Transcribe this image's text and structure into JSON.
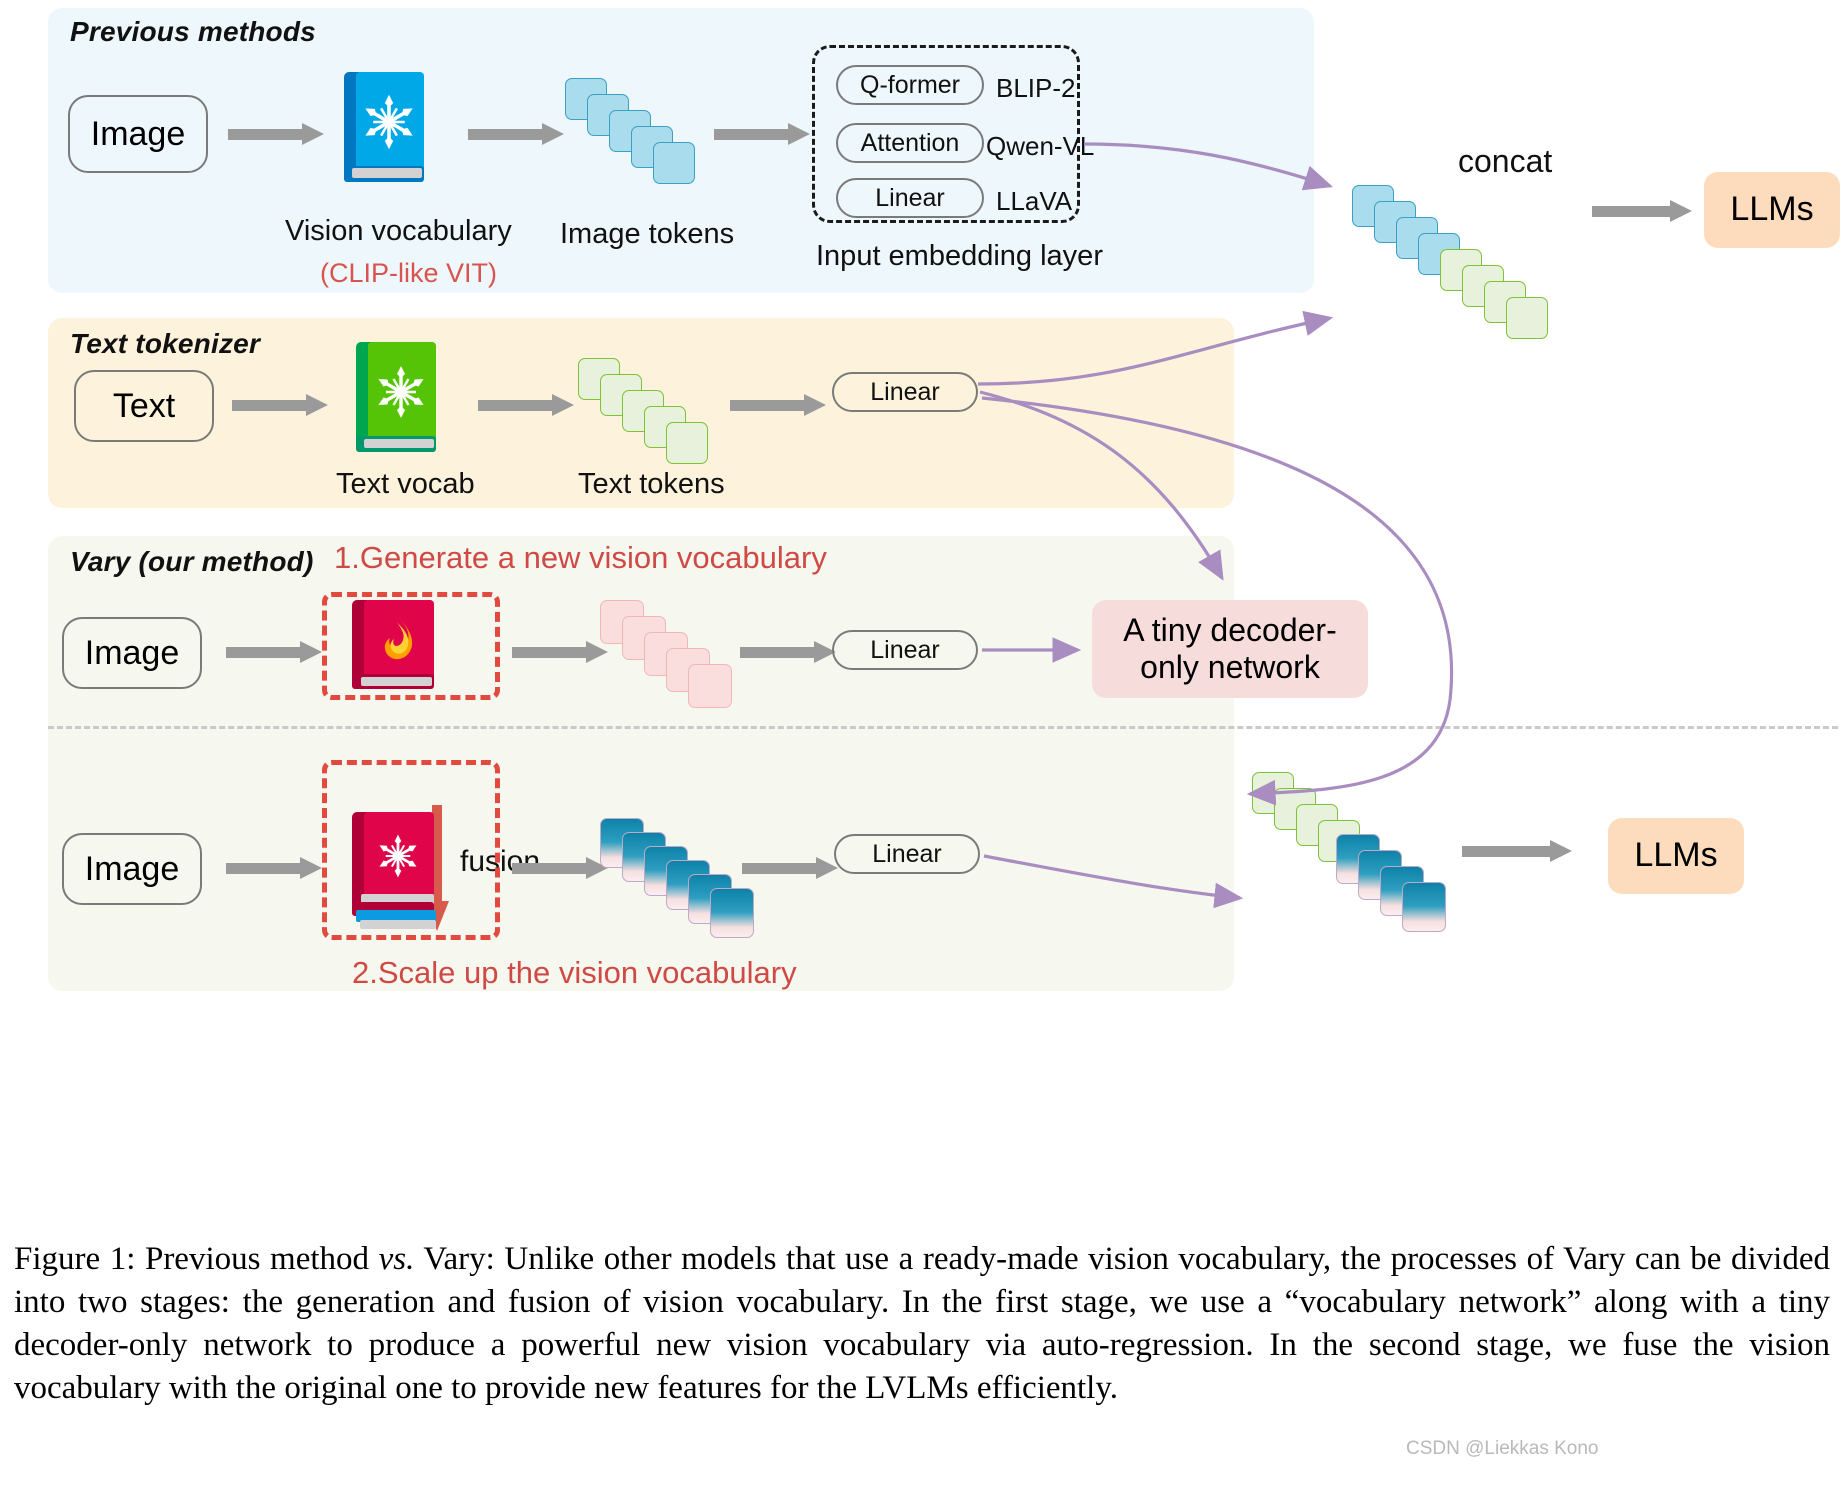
{
  "panels": {
    "previous": {
      "title": "Previous methods"
    },
    "text": {
      "title": "Text tokenizer"
    },
    "vary": {
      "title": "Vary (our method)"
    }
  },
  "previous_row": {
    "input_label": "Image",
    "vocab_label": "Vision vocabulary",
    "vocab_sub": "(CLIP-like VIT)",
    "tokens_label": "Image tokens",
    "embedding_layer_label": "Input embedding layer",
    "embedding_methods": [
      {
        "op": "Q-former",
        "model": "BLIP-2"
      },
      {
        "op": "Attention",
        "model": "Qwen-VL"
      },
      {
        "op": "Linear",
        "model": "LLaVA"
      }
    ],
    "concat_label": "concat",
    "llm_label": "LLMs"
  },
  "text_row": {
    "input_label": "Text",
    "vocab_label": "Text vocab",
    "tokens_label": "Text tokens",
    "linear_label": "Linear"
  },
  "vary_stage1": {
    "step_label": "1.Generate a new vision vocabulary",
    "input_label": "Image",
    "linear_label": "Linear",
    "decoder_label": "A tiny decoder-\nonly network",
    "decoder_line1": "A tiny decoder-",
    "decoder_line2": "only network"
  },
  "vary_fusion": {
    "label": "fusion"
  },
  "vary_stage2": {
    "step_label": "2.Scale up the vision vocabulary",
    "input_label": "Image",
    "linear_label": "Linear",
    "llm_label": "LLMs"
  },
  "icons": {
    "frozen": "snowflake-icon",
    "trainable": "flame-icon"
  },
  "colors": {
    "panel_previous_bg": "#eef7fb",
    "panel_text_bg": "#fdf3dd",
    "panel_vary_bg": "#f6f7ef",
    "llm_bg": "#fcdcbc",
    "decoder_bg": "#f7dcdc",
    "arrow_gray": "#9a9a9a",
    "curve_purple": "#a98cc0",
    "accent_red": "#d9534f",
    "token_blue": "#a9dced",
    "token_green": "#e7f1dc",
    "token_pink": "#fadede",
    "book_blue": "#00a0e4",
    "book_green": "#56c406",
    "book_red": "#e0054b"
  },
  "caption": {
    "prefix": "Figure 1: Previous method ",
    "italic": "vs.",
    "rest": " Vary: Unlike other models that use a ready-made vision vocabulary, the processes of Vary can be divided into two stages: the generation and fusion of vision vocabulary. In the first stage, we use a “vocabulary network” along with a tiny decoder-only network to produce a powerful new vision vocabulary via auto-regression. In the second stage, we fuse the vision vocabulary with the original one to provide new features for the LVLMs efficiently."
  },
  "watermark": {
    "text": "CSDN @Liekkas Kono"
  }
}
